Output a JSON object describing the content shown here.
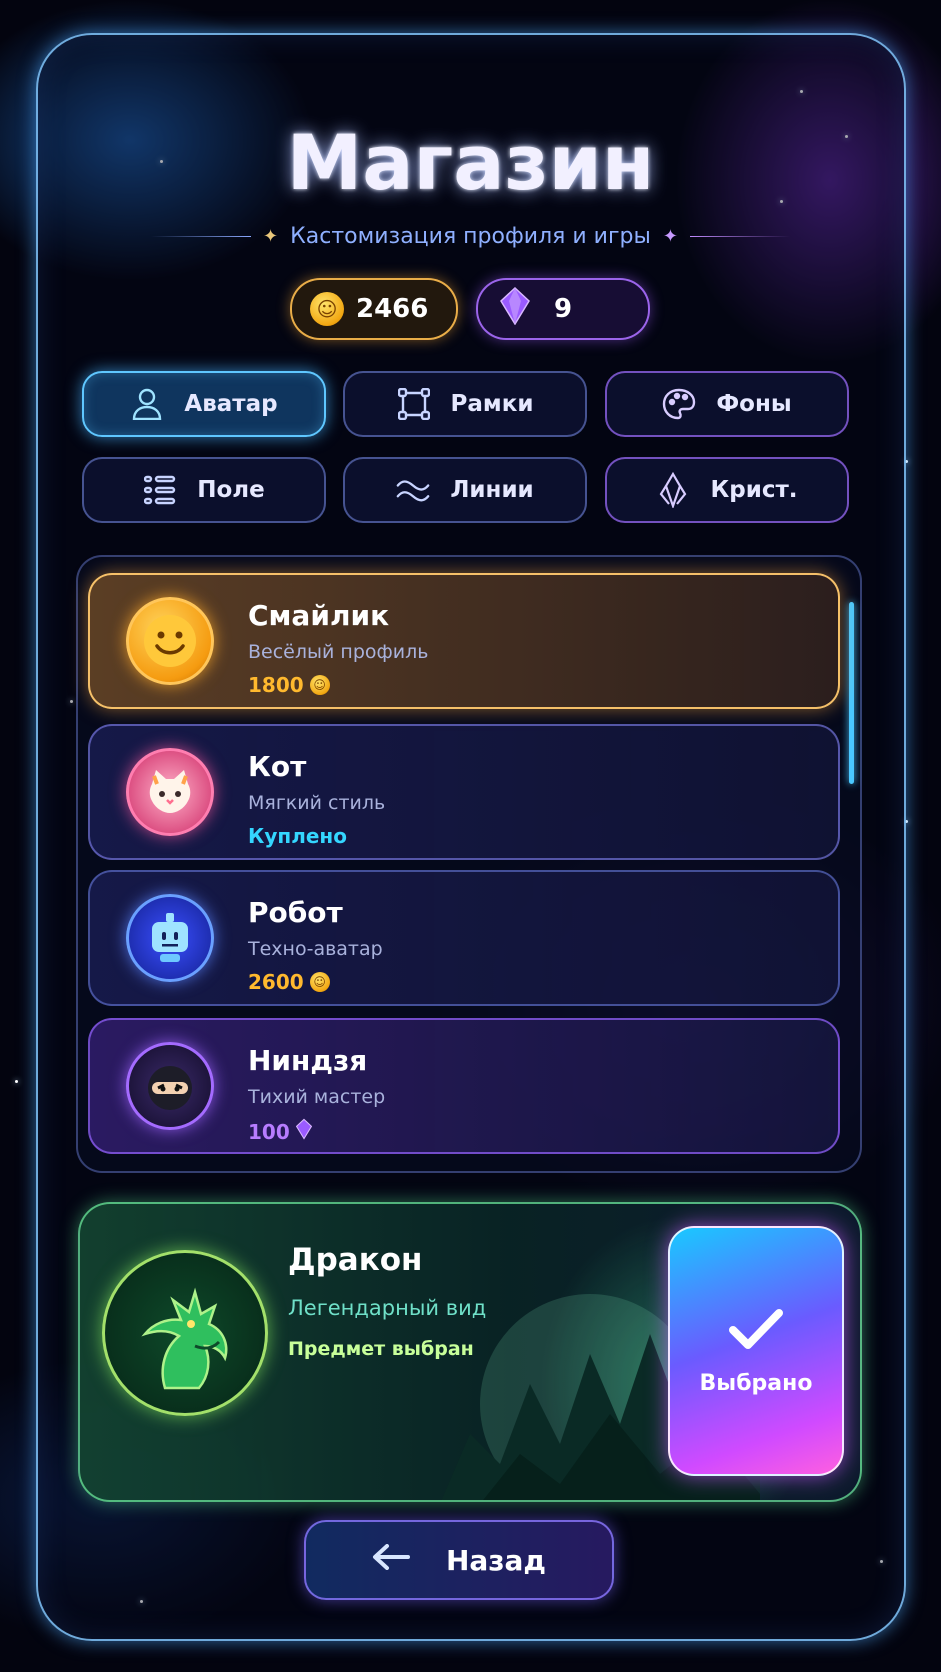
{
  "header": {
    "title": "Магазин",
    "subtitle": "Кастомизация профиля и игры"
  },
  "wallet": {
    "coins": "2466",
    "gems": "9"
  },
  "tabs": [
    {
      "label": "Аватар",
      "icon": "user-icon",
      "active": true
    },
    {
      "label": "Рамки",
      "icon": "frame-icon",
      "active": false
    },
    {
      "label": "Фоны",
      "icon": "palette-icon",
      "active": false
    },
    {
      "label": "Поле",
      "icon": "grid-icon",
      "active": false
    },
    {
      "label": "Линии",
      "icon": "waves-icon",
      "active": false
    },
    {
      "label": "Крист.",
      "icon": "crystal-icon",
      "active": false
    }
  ],
  "items": [
    {
      "name": "Смайлик",
      "desc": "Весёлый профиль",
      "price": "1800",
      "currency": "coin-icon",
      "status": ""
    },
    {
      "name": "Кот",
      "desc": "Мягкий стиль",
      "price": "",
      "currency": "",
      "status": "Куплено"
    },
    {
      "name": "Робот",
      "desc": "Техно-аватар",
      "price": "2600",
      "currency": "coin-icon",
      "status": ""
    },
    {
      "name": "Ниндзя",
      "desc": "Тихий мастер",
      "price": "100",
      "currency": "gem-icon",
      "status": ""
    }
  ],
  "featured": {
    "name": "Дракон",
    "desc": "Легендарный вид",
    "status": "Предмет выбран",
    "button_label": "Выбрано"
  },
  "footer": {
    "back_label": "Назад"
  },
  "colors": {
    "accent_cyan": "#34d6ff",
    "accent_gold": "#ffb92e",
    "accent_violet": "#b77cff",
    "accent_green": "#78ffaa"
  }
}
